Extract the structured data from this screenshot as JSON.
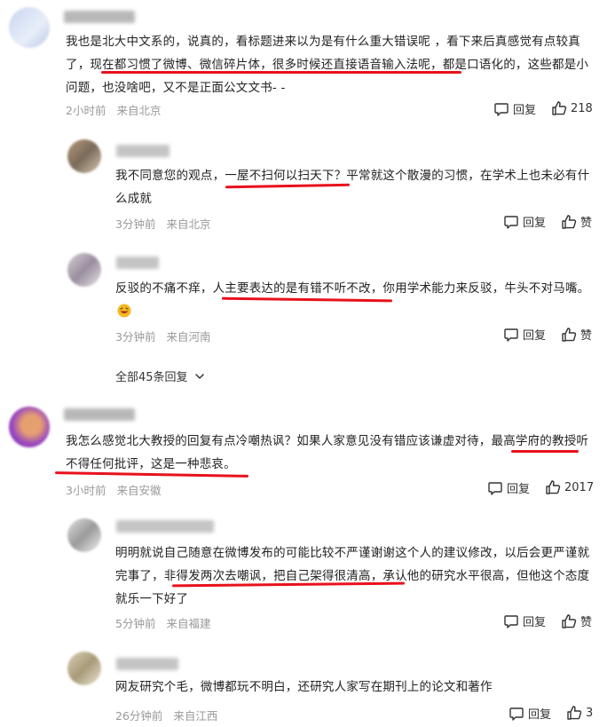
{
  "comments": [
    {
      "text": "我也是北大中文系的，说真的，看标题进来以为是有什么重大错误呢 ，看下来后真感觉有点较真了，现在都习惯了微博、微信碎片体，很多时候还直接语音输入法呢，都是口语化的，这些都是小问题，也没啥吧，又不是正面公文文书- -",
      "time": "2小时前",
      "location": "来自北京",
      "reply_label": "回复",
      "like_count": "218",
      "replies": [
        {
          "text": "我不同意您的观点，一屋不扫何以扫天下？平常就这个散漫的习惯，在学术上也未必有什么成就",
          "time": "3分钟前",
          "location": "来自北京",
          "reply_label": "回复",
          "like_label": "赞"
        },
        {
          "text": "反驳的不痛不痒，人主要表达的是有错不听不改，你用学术能力来反驳，牛头不对马嘴。",
          "time": "3分钟前",
          "location": "来自河南",
          "reply_label": "回复",
          "like_label": "赞"
        }
      ],
      "more_replies": "全部45条回复"
    },
    {
      "text": "我怎么感觉北大教授的回复有点冷嘲热讽？如果人家意见没有错应该谦虚对待，最高学府的教授听不得任何批评，这是一种悲哀。",
      "time": "3小时前",
      "location": "来自安徽",
      "reply_label": "回复",
      "like_count": "2017",
      "replies": [
        {
          "text": "明明就说自己随意在微博发布的可能比较不严谨谢谢这个人的建议修改，以后会更严谨就完事了，非得发两次去嘲讽，把自己架得很清高，承认他的研究水平很高，但他这个态度就乐一下好了",
          "time": "5分钟前",
          "location": "来自福建",
          "reply_label": "回复",
          "like_label": "赞"
        },
        {
          "text": "网友研究个毛，微博都玩不明白，还研究人家写在期刊上的论文和著作",
          "time": "26分钟前",
          "location": "来自江西",
          "reply_label": "回复",
          "like_count": "3"
        }
      ]
    }
  ],
  "colors": {
    "underline": "#e8111b",
    "meta": "#999999"
  },
  "icons": [
    "comment-icon",
    "thumbs-up-icon",
    "chevron-down-icon",
    "laughing-emoji"
  ]
}
